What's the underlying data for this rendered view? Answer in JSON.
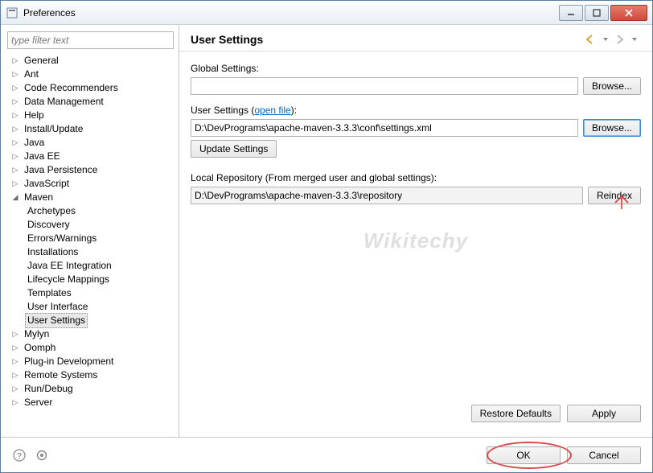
{
  "window": {
    "title": "Preferences"
  },
  "filter": {
    "placeholder": "type filter text"
  },
  "tree": {
    "items": [
      {
        "label": "General",
        "expandable": true,
        "expanded": false
      },
      {
        "label": "Ant",
        "expandable": true,
        "expanded": false
      },
      {
        "label": "Code Recommenders",
        "expandable": true,
        "expanded": false
      },
      {
        "label": "Data Management",
        "expandable": true,
        "expanded": false
      },
      {
        "label": "Help",
        "expandable": true,
        "expanded": false
      },
      {
        "label": "Install/Update",
        "expandable": true,
        "expanded": false
      },
      {
        "label": "Java",
        "expandable": true,
        "expanded": false
      },
      {
        "label": "Java EE",
        "expandable": true,
        "expanded": false
      },
      {
        "label": "Java Persistence",
        "expandable": true,
        "expanded": false
      },
      {
        "label": "JavaScript",
        "expandable": true,
        "expanded": false
      },
      {
        "label": "Maven",
        "expandable": true,
        "expanded": true,
        "children": [
          {
            "label": "Archetypes"
          },
          {
            "label": "Discovery"
          },
          {
            "label": "Errors/Warnings"
          },
          {
            "label": "Installations"
          },
          {
            "label": "Java EE Integration"
          },
          {
            "label": "Lifecycle Mappings"
          },
          {
            "label": "Templates"
          },
          {
            "label": "User Interface"
          },
          {
            "label": "User Settings",
            "selected": true
          }
        ]
      },
      {
        "label": "Mylyn",
        "expandable": true,
        "expanded": false
      },
      {
        "label": "Oomph",
        "expandable": true,
        "expanded": false
      },
      {
        "label": "Plug-in Development",
        "expandable": true,
        "expanded": false
      },
      {
        "label": "Remote Systems",
        "expandable": true,
        "expanded": false
      },
      {
        "label": "Run/Debug",
        "expandable": true,
        "expanded": false
      },
      {
        "label": "Server",
        "expandable": true,
        "expanded": false
      }
    ]
  },
  "page": {
    "title": "User Settings",
    "global_label": "Global Settings:",
    "global_value": "",
    "user_label_prefix": "User Settings (",
    "user_label_link": "open file",
    "user_label_suffix": "):",
    "user_value": "D:\\DevPrograms\\apache-maven-3.3.3\\conf\\settings.xml",
    "browse_label": "Browse...",
    "update_label": "Update Settings",
    "local_repo_label": "Local Repository (From merged user and global settings):",
    "local_repo_value": "D:\\DevPrograms\\apache-maven-3.3.3\\repository",
    "reindex_label": "Reindex",
    "restore_label": "Restore Defaults",
    "apply_label": "Apply"
  },
  "footer": {
    "ok_label": "OK",
    "cancel_label": "Cancel"
  },
  "watermark": "Wikitechy"
}
